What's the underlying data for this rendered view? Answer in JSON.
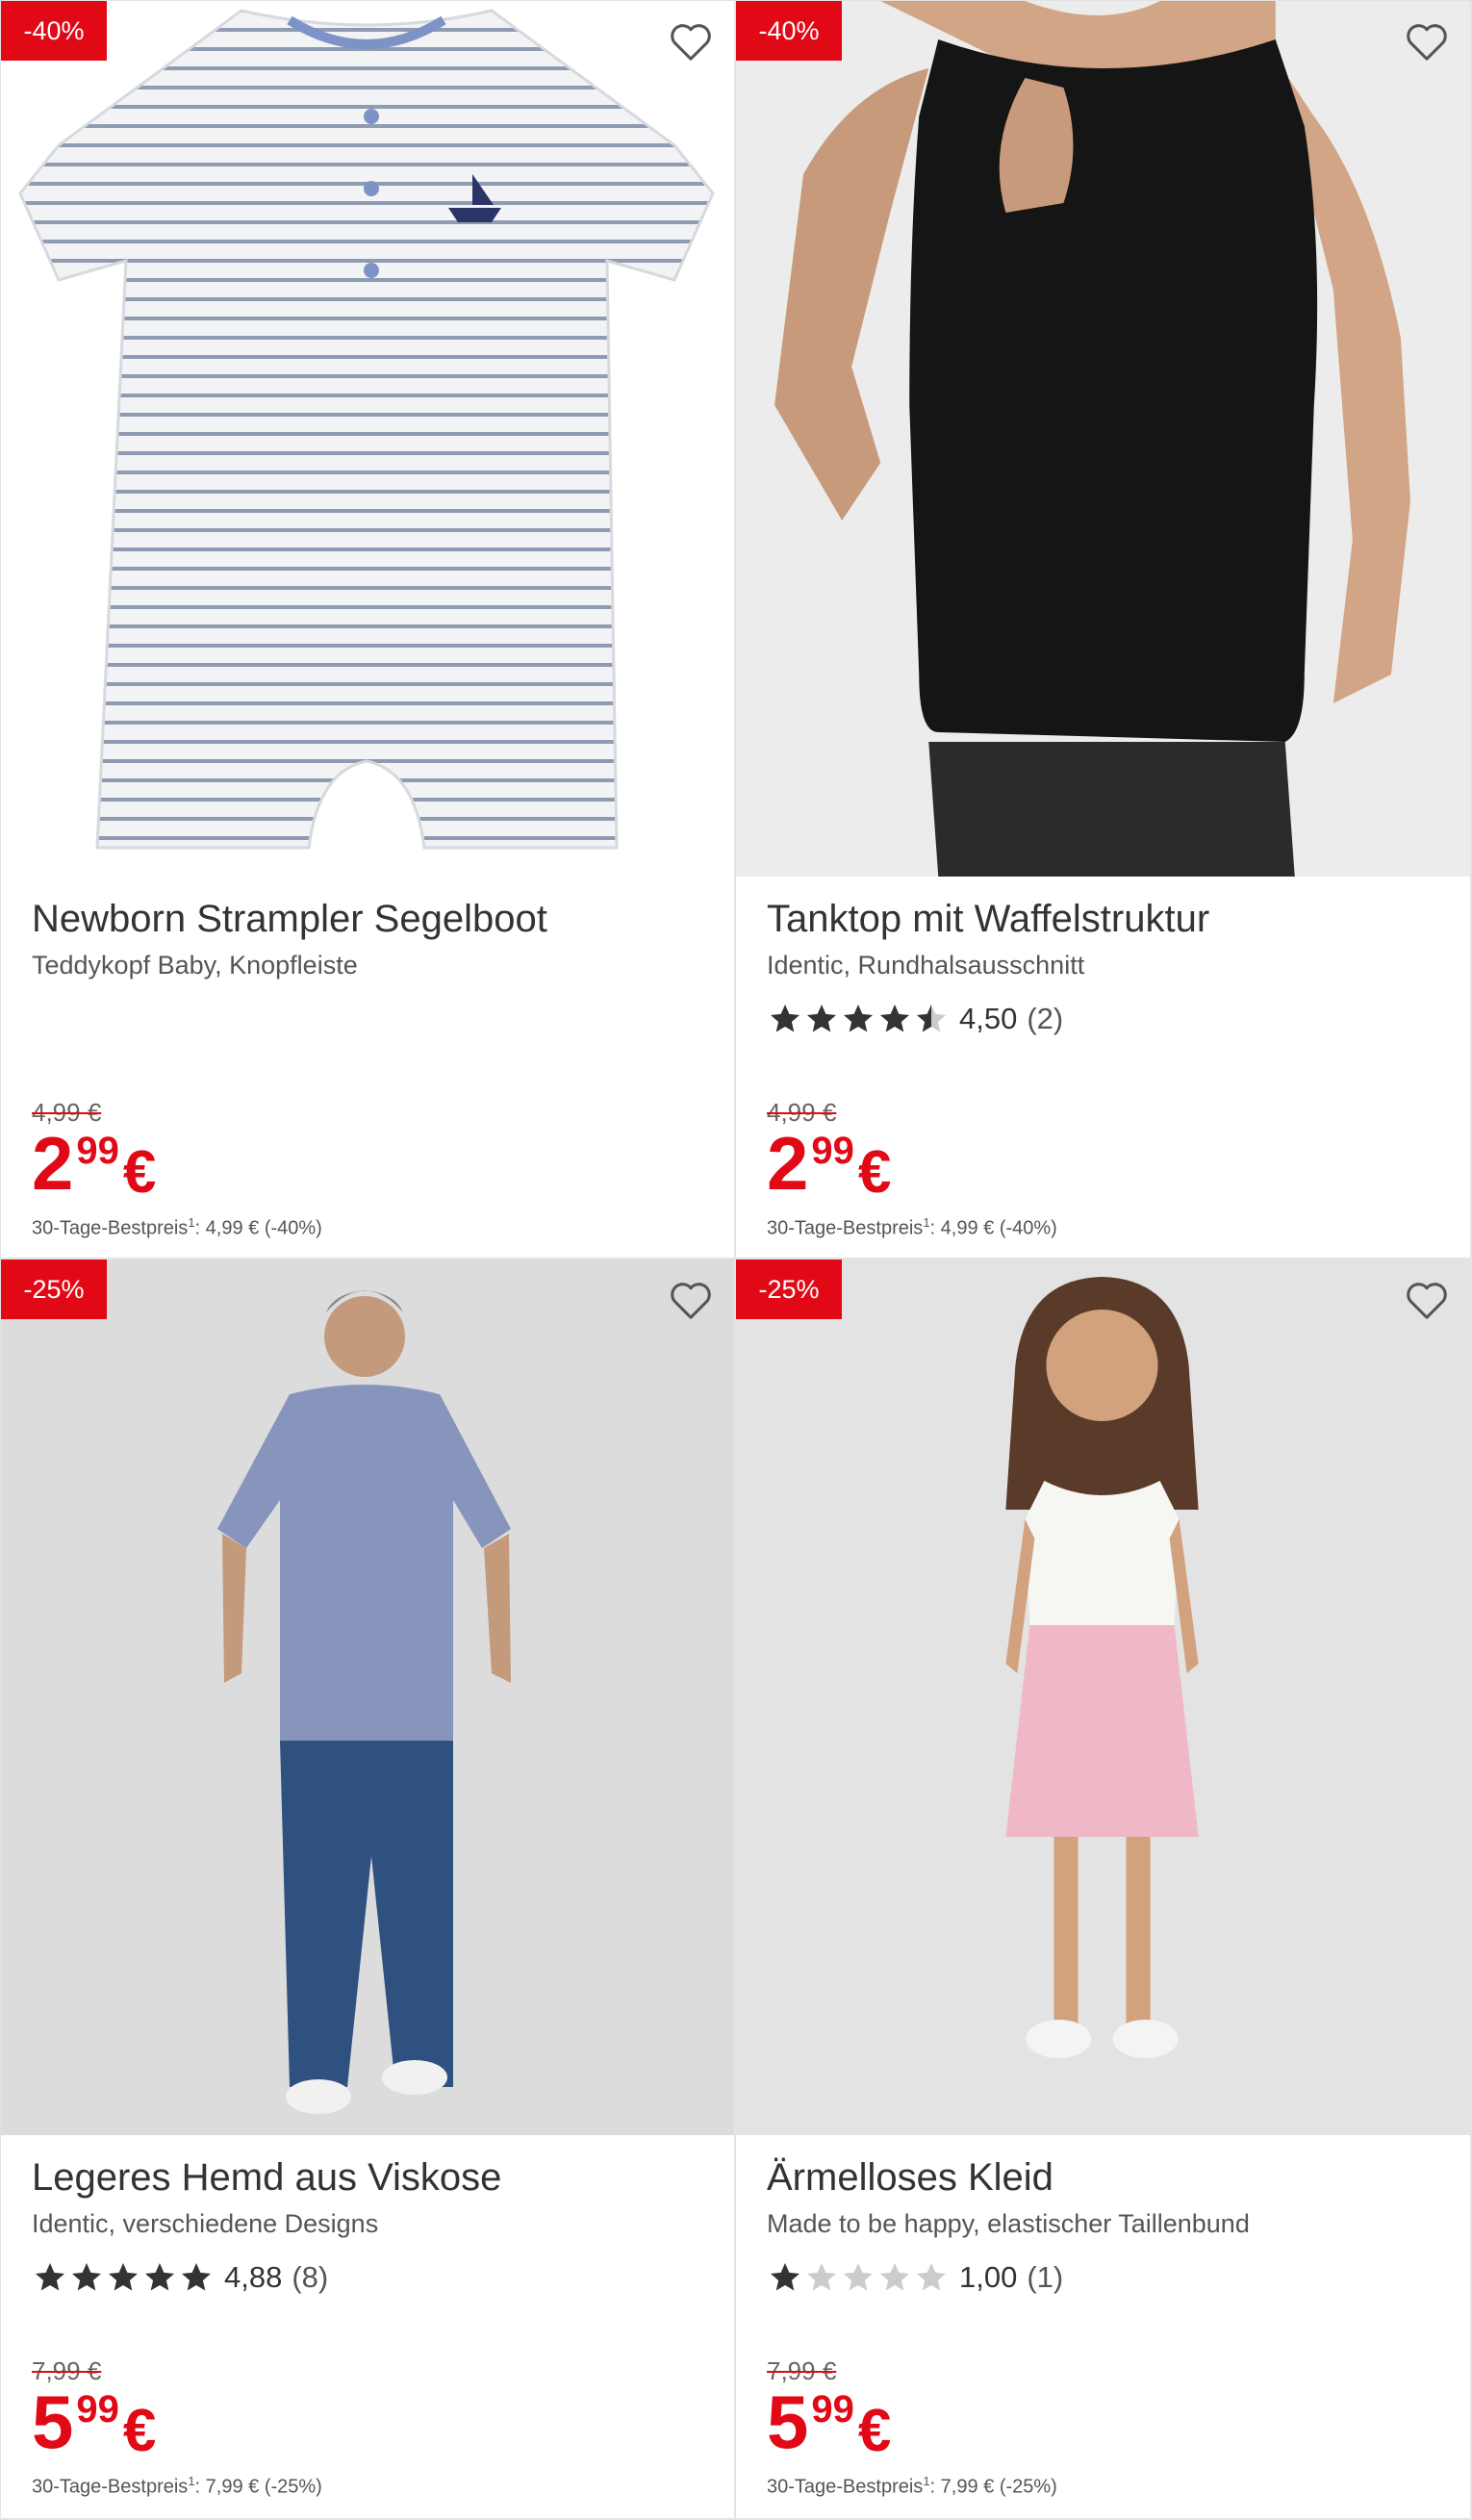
{
  "colors": {
    "accent_red": "#e10915",
    "text": "#333333",
    "star_filled": "#333333",
    "star_empty": "#cccccc"
  },
  "products": [
    {
      "discount_badge": "-40%",
      "title": "Newborn Strampler Segelboot",
      "subtitle": "Teddykopf Baby, Knopfleiste",
      "rating": null,
      "old_price": "4,99 €",
      "price": {
        "euros": "2",
        "cents": "99",
        "currency": "€"
      },
      "best_price_label": "30-Tage-Bestpreis",
      "best_price_footnote": "1",
      "best_price_value": ": 4,99 € (-40%)",
      "image_icon": "striped-baby-romper-image",
      "has_ai_sparkle": false
    },
    {
      "discount_badge": "-40%",
      "title": "Tanktop mit Waffelstruktur",
      "subtitle": "Identic, Rundhalsausschnitt",
      "rating": {
        "value": "4,50",
        "count": "(2)",
        "stars": 4.5
      },
      "old_price": "4,99 €",
      "price": {
        "euros": "2",
        "cents": "99",
        "currency": "€"
      },
      "best_price_label": "30-Tage-Bestpreis",
      "best_price_footnote": "1",
      "best_price_value": ": 4,99 € (-40%)",
      "image_icon": "black-tanktop-model-image",
      "has_ai_sparkle": false
    },
    {
      "discount_badge": "-25%",
      "title": "Legeres Hemd aus Viskose",
      "subtitle": "Identic, verschiedene Designs",
      "rating": {
        "value": "4,88",
        "count": "(8)",
        "stars": 5
      },
      "old_price": "7,99 €",
      "price": {
        "euros": "5",
        "cents": "99",
        "currency": "€"
      },
      "best_price_label": "30-Tage-Bestpreis",
      "best_price_footnote": "1",
      "best_price_value": ": 7,99 € (-25%)",
      "image_icon": "man-in-printed-shirt-image",
      "has_ai_sparkle": true
    },
    {
      "discount_badge": "-25%",
      "title": "Ärmelloses Kleid",
      "subtitle": "Made to be happy, elastischer Taillenbund",
      "rating": {
        "value": "1,00",
        "count": "(1)",
        "stars": 1
      },
      "old_price": "7,99 €",
      "price": {
        "euros": "5",
        "cents": "99",
        "currency": "€"
      },
      "best_price_label": "30-Tage-Bestpreis",
      "best_price_footnote": "1",
      "best_price_value": ": 7,99 € (-25%)",
      "image_icon": "girl-in-pink-dress-image",
      "has_ai_sparkle": true
    }
  ]
}
